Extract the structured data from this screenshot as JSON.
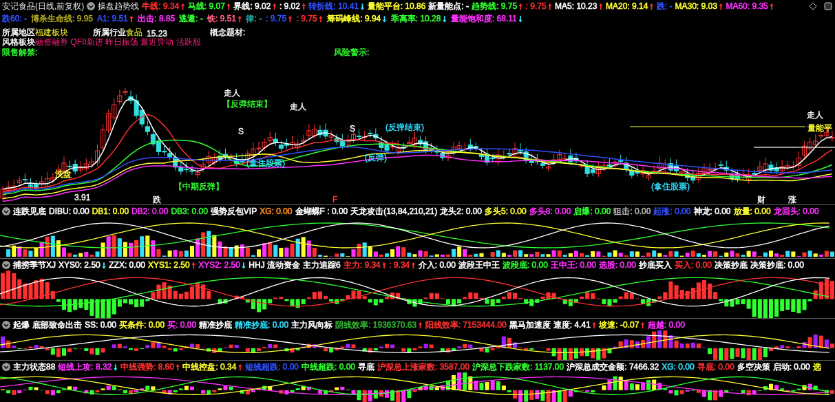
{
  "main_panel": {
    "title": "安记食品(日线,前复权)",
    "indicator": "操盘趋势线",
    "rows": [
      {
        "items": [
          {
            "text": "牛线: 9.34",
            "color": "#ff3030",
            "arrow": {
              "text": "↑",
              "color": "#ff3030"
            }
          },
          {
            "text": "马线: 9.07",
            "color": "#30ff30",
            "arrow": {
              "text": "↑",
              "color": "#ff3030"
            }
          },
          {
            "text": "界线: 9.02",
            "color": "#ffffff",
            "arrow": {
              "text": "↑",
              "color": "#ff3030"
            }
          },
          {
            "text": ": 9.02",
            "color": "#ffffff",
            "arrow": {
              "text": "↑",
              "color": "#ff3030"
            }
          },
          {
            "text": "转折线: 10.41",
            "color": "#3050ff",
            "arrow": {
              "text": "↓",
              "color": "#30e0ff"
            }
          },
          {
            "text": "量能平台: 10.86",
            "color": "#ffff30"
          },
          {
            "text": "新量能点: -",
            "color": "#ffffff"
          },
          {
            "text": "趋势线: 9.75",
            "color": "#30ff30",
            "arrow": {
              "text": "↑",
              "color": "#ff3030"
            }
          },
          {
            "text": ": 9.75",
            "color": "#ff3030",
            "arrow": {
              "text": "↑",
              "color": "#ff3030"
            }
          },
          {
            "text": "MA5: 10.23",
            "color": "#ffffff",
            "arrow": {
              "text": "↑",
              "color": "#ff3030"
            }
          },
          {
            "text": "MA20: 9.14",
            "color": "#ffff30",
            "arrow": {
              "text": "↑",
              "color": "#ff3030"
            }
          },
          {
            "text": "跌: -",
            "color": "#3050ff"
          },
          {
            "text": "MA30: 9.03",
            "color": "#ffff30",
            "arrow": {
              "text": "↑",
              "color": "#ff3030"
            }
          },
          {
            "text": "MA60: 9.35",
            "color": "#ff30ff",
            "arrow": {
              "text": "↑",
              "color": "#ff3030"
            }
          }
        ]
      },
      {
        "items": [
          {
            "text": "跌60: -",
            "color": "#3050ff"
          },
          {
            "text": "博杀生命线: 9.95",
            "color": "#a8a020"
          },
          {
            "text": "A1: 9.51",
            "color": "#3050ff",
            "arrow": {
              "text": "↑",
              "color": "#ff3030"
            }
          },
          {
            "text": "出击: 8.85",
            "color": "#ff30ff"
          },
          {
            "text": "逃遁: -",
            "color": "#30ff30"
          },
          {
            "text": "铁: 9.51",
            "color": "#ff6080",
            "arrow": {
              "text": "↑",
              "color": "#ff3030"
            }
          },
          {
            "text": "律: -",
            "color": "#20a0a0"
          },
          {
            "text": ": 9.75",
            "color": "#3050ff",
            "arrow": {
              "text": "↑",
              "color": "#ff3030"
            }
          },
          {
            "text": ": 9.75",
            "color": "#ff3030",
            "arrow": {
              "text": "↑",
              "color": "#ff3030"
            }
          },
          {
            "text": "筹码峰线: 9.94",
            "color": "#ffff30",
            "arrow": {
              "text": "↓",
              "color": "#30e0ff"
            }
          },
          {
            "text": "乖离率: 10.28",
            "color": "#30ff30",
            "arrow": {
              "text": "↓",
              "color": "#30e0ff"
            }
          },
          {
            "text": "量能饱和度: 68.11",
            "color": "#ff30ff",
            "arrow": {
              "text": "↓",
              "color": "#30e0ff"
            }
          }
        ]
      }
    ],
    "stock_info": [
      {
        "label": "所属地区",
        "value": "福建板块",
        "color": "#ffffff"
      },
      {
        "label": "所属行业",
        "value": "食品",
        "color": "#ffffff"
      },
      {
        "label": "概念题材:",
        "color": "#ffffff"
      },
      {
        "label": "风格板块",
        "value": "融资融券 QFII新进 昨日振荡 最近异动 活跃股",
        "color": "#ffffff"
      },
      {
        "label": "限售解禁:",
        "color": "#30ff30"
      },
      {
        "label": "风险警示:",
        "color": "#30ff30"
      }
    ],
    "annotations": [
      {
        "text": "走人",
        "color": "#ffffff"
      },
      {
        "text": "【反弹结束】",
        "color": "#30ff30"
      },
      {
        "text": "走人",
        "color": "#ffffff"
      },
      {
        "text": "(反弹结束)",
        "color": "#30e0ff"
      },
      {
        "text": "(反弹)",
        "color": "#30e0ff"
      },
      {
        "text": "(拿住股票)",
        "color": "#30e0ff"
      },
      {
        "text": "【中期反弹】",
        "color": "#30ff30"
      },
      {
        "text": "(拿住股票)",
        "color": "#30e0ff"
      },
      {
        "text": "走人",
        "color": "#ffffff"
      },
      {
        "text": "量能平",
        "color": "#ffff30"
      },
      {
        "text": "15.23",
        "color": "#ffffff"
      },
      {
        "text": "3.91",
        "color": "#ffffff"
      },
      {
        "text": "S",
        "color": "#ffffff"
      },
      {
        "text": "S",
        "color": "#ffffff"
      },
      {
        "text": "跌",
        "color": "#ffffff"
      },
      {
        "text": "财",
        "color": "#ffffff"
      },
      {
        "text": "涨",
        "color": "#ffffff"
      },
      {
        "text": "洗盘",
        "color": "#ffff30"
      },
      {
        "text": "F",
        "color": "#ff3030"
      }
    ]
  },
  "panels": [
    {
      "items": [
        {
          "text": "连跌见底",
          "color": "#ffffff"
        },
        {
          "text": "DIBU: 0.00",
          "color": "#ffffff"
        },
        {
          "text": "DB1: 0.00",
          "color": "#ffff30"
        },
        {
          "text": "DB2: 0.00",
          "color": "#ff30ff"
        },
        {
          "text": "DB3: 0.00",
          "color": "#30ff30"
        },
        {
          "text": "强势反包VIP",
          "color": "#ffffff"
        },
        {
          "text": "XG: 0.00",
          "color": "#ff9020"
        },
        {
          "text": "金蝴蝶F : 0.00",
          "color": "#ffffff"
        },
        {
          "text": "天龙攻击(13,84,210,21)",
          "color": "#ffffff"
        },
        {
          "text": "龙头2: 0.00",
          "color": "#ffffff"
        },
        {
          "text": "多头5: 0.00",
          "color": "#ffff30"
        },
        {
          "text": "多头8: 0.00",
          "color": "#ff30ff"
        },
        {
          "text": "启爆: 0.00",
          "color": "#30ff30"
        },
        {
          "text": "狙击: 0.00",
          "color": "#b0b0b0"
        },
        {
          "text": "起涨: 0.00",
          "color": "#3050ff"
        },
        {
          "text": "神龙: 0.00",
          "color": "#ffffff"
        },
        {
          "text": "放量: 0.00",
          "color": "#ffff30"
        },
        {
          "text": "龙回头: 0.00",
          "color": "#ff30ff"
        }
      ]
    },
    {
      "items": [
        {
          "text": "捕捞季节XJ",
          "color": "#ffffff"
        },
        {
          "text": "XYS0: 2.50",
          "color": "#ffffff",
          "arrow": {
            "text": "↓",
            "color": "#30e0ff"
          }
        },
        {
          "text": "ZZX: 0.00",
          "color": "#ffffff"
        },
        {
          "text": "XYS1: 2.50",
          "color": "#ffff30",
          "arrow": {
            "text": "↑",
            "color": "#ff3030"
          }
        },
        {
          "text": "XYS2: 2.50",
          "color": "#ff30ff",
          "arrow": {
            "text": "↓",
            "color": "#30e0ff"
          }
        },
        {
          "text": "HHJ 流动资金",
          "color": "#ffffff"
        },
        {
          "text": "主力追踪6",
          "color": "#ffffff"
        },
        {
          "text": "主力: 9.34",
          "color": "#ff3030",
          "arrow": {
            "text": "↑",
            "color": "#ff3030"
          }
        },
        {
          "text": ": 9.34",
          "color": "#ff3030",
          "arrow": {
            "text": "↑",
            "color": "#ff3030"
          }
        },
        {
          "text": "介入: 0.00",
          "color": "#ffffff"
        },
        {
          "text": "波段王中王",
          "color": "#ffffff"
        },
        {
          "text": "波段底: 0.00",
          "color": "#30ff30"
        },
        {
          "text": "王中王: 0.00",
          "color": "#ff30ff"
        },
        {
          "text": "选股: 0.00",
          "color": "#ff30ff"
        },
        {
          "text": "抄底买入",
          "color": "#ffffff"
        },
        {
          "text": "买入: 0.00",
          "color": "#ff3030"
        },
        {
          "text": "决策抄底",
          "color": "#ffffff"
        },
        {
          "text": "决策抄底: 0.00",
          "color": "#ffffff"
        }
      ]
    },
    {
      "items": [
        {
          "text": "起爆",
          "color": "#ffffff"
        },
        {
          "text": "底部致命出击",
          "color": "#ffffff"
        },
        {
          "text": "SS: 0.00",
          "color": "#ffffff"
        },
        {
          "text": "买条件: 0.00",
          "color": "#ffff30"
        },
        {
          "text": "买: 0.00",
          "color": "#ff30ff"
        },
        {
          "text": "精准抄底",
          "color": "#ffffff"
        },
        {
          "text": "精准抄底: 0.00",
          "color": "#30e0ff"
        },
        {
          "text": "主力风向标",
          "color": "#ffffff"
        },
        {
          "text": "阴线效率: 1936370.63",
          "color": "#30b030",
          "arrow": {
            "text": "↑",
            "color": "#ff3030"
          }
        },
        {
          "text": "阳线效率: 7153444.00",
          "color": "#ff3030"
        },
        {
          "text": "黑马加速度",
          "color": "#ffffff"
        },
        {
          "text": "速度: 4.41",
          "color": "#ffffff",
          "arrow": {
            "text": "↑",
            "color": "#ff3030"
          }
        },
        {
          "text": "坡速: -0.07",
          "color": "#ffff30",
          "arrow": {
            "text": "↑",
            "color": "#ff3030"
          }
        },
        {
          "text": "超越: 0.00",
          "color": "#ff30ff"
        }
      ]
    },
    {
      "items": [
        {
          "text": "主力状态88",
          "color": "#ffffff"
        },
        {
          "text": "短线上攻: 8.32",
          "color": "#ff30ff",
          "arrow": {
            "text": "↓",
            "color": "#30e0ff"
          }
        },
        {
          "text": "中线强势: 8.60",
          "color": "#ff3030",
          "arrow": {
            "text": "↑",
            "color": "#ff3030"
          }
        },
        {
          "text": "中线控盘: 0.34",
          "color": "#ffff30",
          "arrow": {
            "text": "↑",
            "color": "#ff3030"
          }
        },
        {
          "text": "短线超跌: 0.00",
          "color": "#3050ff"
        },
        {
          "text": "中线超跌: 0.00",
          "color": "#30ff30"
        },
        {
          "text": "寻底",
          "color": "#ffffff"
        },
        {
          "text": "沪深总上涨家数: 3587.00",
          "color": "#ff3030"
        },
        {
          "text": "沪深总下跌家数: 1137.00",
          "color": "#30ff30"
        },
        {
          "text": "沪深总成交金额: 7466.32",
          "color": "#ffffff"
        },
        {
          "text": "XG: 0.00",
          "color": "#30e0ff"
        },
        {
          "text": "寻底: 0.00",
          "color": "#ff3030"
        },
        {
          "text": "多空决策",
          "color": "#ffffff"
        },
        {
          "text": "启动: 0.00",
          "color": "#ffffff"
        },
        {
          "text": "选",
          "color": "#ffff30"
        }
      ]
    }
  ]
}
